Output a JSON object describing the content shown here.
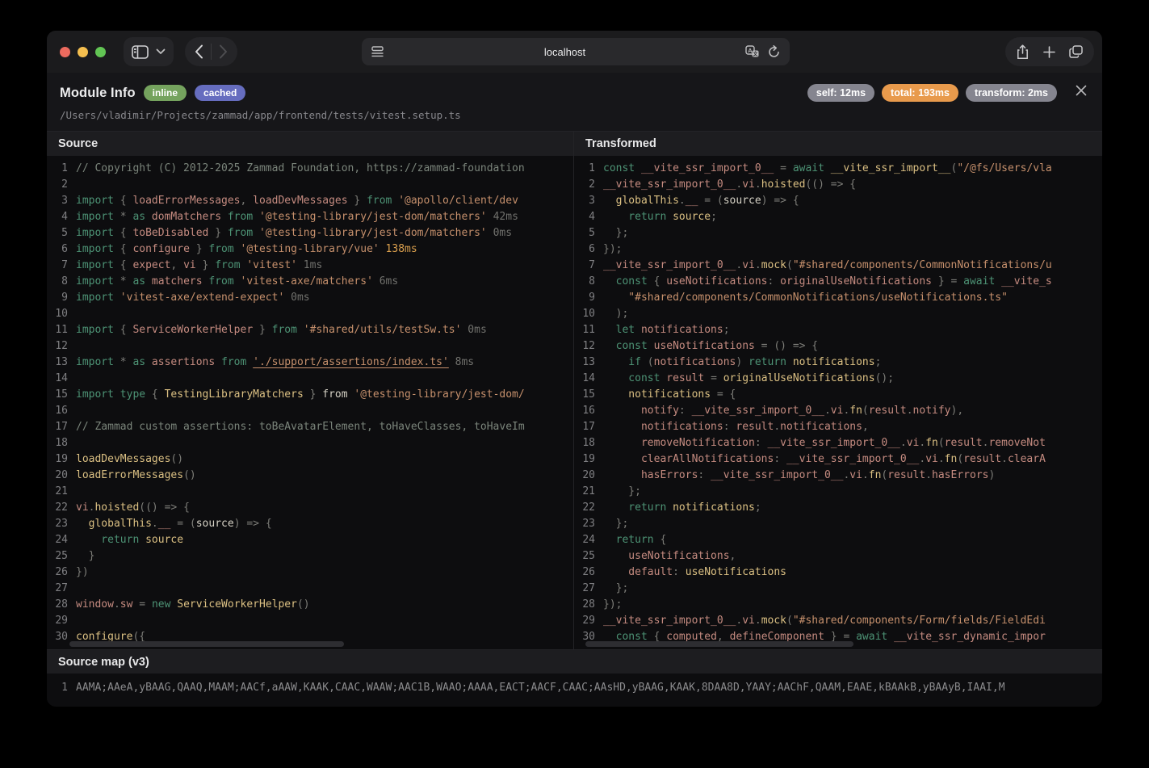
{
  "browser": {
    "url": "localhost"
  },
  "header": {
    "title": "Module Info",
    "badges": [
      {
        "label": "inline",
        "color": "#75a35e"
      },
      {
        "label": "cached",
        "color": "#666dbf"
      }
    ],
    "path": "/Users/vladimir/Projects/zammad/app/frontend/tests/vitest.setup.ts",
    "timings": [
      {
        "label": "self: 12ms",
        "color": "#85858f"
      },
      {
        "label": "total: 193ms",
        "color": "#e89a4c"
      },
      {
        "label": "transform: 2ms",
        "color": "#85858f"
      }
    ]
  },
  "panels": {
    "source": {
      "title": "Source",
      "lines": [
        [
          [
            "c",
            "// Copyright (C) 2012-2025 Zammad Foundation, https://zammad-foundation"
          ]
        ],
        [],
        [
          [
            "k",
            "import"
          ],
          [
            "p",
            " { "
          ],
          [
            "v",
            "loadErrorMessages"
          ],
          [
            "p",
            ", "
          ],
          [
            "v",
            "loadDevMessages"
          ],
          [
            "p",
            " } "
          ],
          [
            "k",
            "from"
          ],
          [
            "s",
            " '@apollo/client/dev"
          ]
        ],
        [
          [
            "k",
            "import"
          ],
          [
            "p",
            " * "
          ],
          [
            "k",
            "as"
          ],
          [
            "v",
            " domMatchers"
          ],
          [
            "k",
            " from"
          ],
          [
            "s",
            " '@testing-library/jest-dom/matchers'"
          ],
          [
            "t",
            " 42ms"
          ]
        ],
        [
          [
            "k",
            "import"
          ],
          [
            "p",
            " { "
          ],
          [
            "v",
            "toBeDisabled"
          ],
          [
            "p",
            " } "
          ],
          [
            "k",
            "from"
          ],
          [
            "s",
            " '@testing-library/jest-dom/matchers'"
          ],
          [
            "t",
            " 0ms"
          ]
        ],
        [
          [
            "k",
            "import"
          ],
          [
            "p",
            " { "
          ],
          [
            "v",
            "configure"
          ],
          [
            "p",
            " } "
          ],
          [
            "k",
            "from"
          ],
          [
            "s",
            " '@testing-library/vue'"
          ],
          [
            "th",
            " 138ms"
          ]
        ],
        [
          [
            "k",
            "import"
          ],
          [
            "p",
            " { "
          ],
          [
            "v",
            "expect"
          ],
          [
            "p",
            ", "
          ],
          [
            "v",
            "vi"
          ],
          [
            "p",
            " } "
          ],
          [
            "k",
            "from"
          ],
          [
            "s",
            " 'vitest'"
          ],
          [
            "t",
            " 1ms"
          ]
        ],
        [
          [
            "k",
            "import"
          ],
          [
            "p",
            " * "
          ],
          [
            "k",
            "as"
          ],
          [
            "v",
            " matchers"
          ],
          [
            "k",
            " from"
          ],
          [
            "s",
            " 'vitest-axe/matchers'"
          ],
          [
            "t",
            " 6ms"
          ]
        ],
        [
          [
            "k",
            "import"
          ],
          [
            "s",
            " 'vitest-axe/extend-expect'"
          ],
          [
            "t",
            " 0ms"
          ]
        ],
        [],
        [
          [
            "k",
            "import"
          ],
          [
            "p",
            " { "
          ],
          [
            "v",
            "ServiceWorkerHelper"
          ],
          [
            "p",
            " } "
          ],
          [
            "k",
            "from"
          ],
          [
            "s",
            " '#shared/utils/testSw.ts'"
          ],
          [
            "t",
            " 0ms"
          ]
        ],
        [],
        [
          [
            "k",
            "import"
          ],
          [
            "p",
            " * "
          ],
          [
            "k",
            "as"
          ],
          [
            "v",
            " assertions"
          ],
          [
            "k",
            " from "
          ],
          [
            "u",
            "'./support/assertions/index.ts'"
          ],
          [
            "t",
            " 8ms"
          ]
        ],
        [],
        [
          [
            "k",
            "import type"
          ],
          [
            "p",
            " { "
          ],
          [
            "f",
            "TestingLibraryMatchers"
          ],
          [
            "p",
            " } "
          ],
          [
            "w",
            "from"
          ],
          [
            "s",
            " '@testing-library/jest-dom/"
          ]
        ],
        [],
        [
          [
            "c",
            "// Zammad custom assertions: toBeAvatarElement, toHaveClasses, toHaveIm"
          ]
        ],
        [],
        [
          [
            "f",
            "loadDevMessages"
          ],
          [
            "p",
            "()"
          ]
        ],
        [
          [
            "f",
            "loadErrorMessages"
          ],
          [
            "p",
            "()"
          ]
        ],
        [],
        [
          [
            "v",
            "vi"
          ],
          [
            "p",
            "."
          ],
          [
            "f",
            "hoisted"
          ],
          [
            "p",
            "(() => {"
          ]
        ],
        [
          [
            "f",
            "  globalThis"
          ],
          [
            "p",
            "."
          ],
          [
            "v",
            "__"
          ],
          [
            "p",
            " = ("
          ],
          [
            "w",
            "source"
          ],
          [
            "p",
            ") => {"
          ]
        ],
        [
          [
            "k",
            "    return"
          ],
          [
            "f",
            " source"
          ]
        ],
        [
          [
            "p",
            "  }"
          ]
        ],
        [
          [
            "p",
            "})"
          ]
        ],
        [],
        [
          [
            "v",
            "window"
          ],
          [
            "p",
            "."
          ],
          [
            "v",
            "sw"
          ],
          [
            "p",
            " = "
          ],
          [
            "k",
            "new"
          ],
          [
            "f",
            " ServiceWorkerHelper"
          ],
          [
            "p",
            "()"
          ]
        ],
        [],
        [
          [
            "f",
            "configure"
          ],
          [
            "p",
            "({"
          ]
        ]
      ]
    },
    "transformed": {
      "title": "Transformed",
      "lines": [
        [
          [
            "k",
            "const"
          ],
          [
            "v",
            " __vite_ssr_import_0__"
          ],
          [
            "p",
            " = "
          ],
          [
            "k",
            "await"
          ],
          [
            "f",
            " __vite_ssr_import__"
          ],
          [
            "p",
            "("
          ],
          [
            "s",
            "\"/@fs/Users/vla"
          ]
        ],
        [
          [
            "v",
            "__vite_ssr_import_0__"
          ],
          [
            "p",
            "."
          ],
          [
            "v",
            "vi"
          ],
          [
            "p",
            "."
          ],
          [
            "f",
            "hoisted"
          ],
          [
            "p",
            "(() => {"
          ]
        ],
        [
          [
            "f",
            "  globalThis"
          ],
          [
            "p",
            "."
          ],
          [
            "v",
            "__"
          ],
          [
            "p",
            " = ("
          ],
          [
            "w",
            "source"
          ],
          [
            "p",
            ") => {"
          ]
        ],
        [
          [
            "k",
            "    return"
          ],
          [
            "f",
            " source"
          ],
          [
            "p",
            ";"
          ]
        ],
        [
          [
            "p",
            "  };"
          ]
        ],
        [
          [
            "p",
            "});"
          ]
        ],
        [
          [
            "v",
            "__vite_ssr_import_0__"
          ],
          [
            "p",
            "."
          ],
          [
            "v",
            "vi"
          ],
          [
            "p",
            "."
          ],
          [
            "f",
            "mock"
          ],
          [
            "p",
            "("
          ],
          [
            "s",
            "\"#shared/components/CommonNotifications/u"
          ]
        ],
        [
          [
            "k",
            "  const"
          ],
          [
            "p",
            " { "
          ],
          [
            "v",
            "useNotifications"
          ],
          [
            "p",
            ": "
          ],
          [
            "v",
            "originalUseNotifications"
          ],
          [
            "p",
            " } = "
          ],
          [
            "k",
            "await"
          ],
          [
            "v",
            " __vite_s"
          ]
        ],
        [
          [
            "s",
            "    \"#shared/components/CommonNotifications/useNotifications.ts\""
          ]
        ],
        [
          [
            "p",
            "  );"
          ]
        ],
        [
          [
            "k",
            "  let"
          ],
          [
            "v",
            " notifications"
          ],
          [
            "p",
            ";"
          ]
        ],
        [
          [
            "k",
            "  const"
          ],
          [
            "v",
            " useNotifications"
          ],
          [
            "p",
            " = () => {"
          ]
        ],
        [
          [
            "k",
            "    if"
          ],
          [
            "p",
            " ("
          ],
          [
            "v",
            "notifications"
          ],
          [
            "p",
            ") "
          ],
          [
            "k",
            "return"
          ],
          [
            "f",
            " notifications"
          ],
          [
            "p",
            ";"
          ]
        ],
        [
          [
            "k",
            "    const"
          ],
          [
            "v",
            " result"
          ],
          [
            "p",
            " = "
          ],
          [
            "f",
            "originalUseNotifications"
          ],
          [
            "p",
            "();"
          ]
        ],
        [
          [
            "f",
            "    notifications"
          ],
          [
            "p",
            " = {"
          ]
        ],
        [
          [
            "v",
            "      notify"
          ],
          [
            "p",
            ": "
          ],
          [
            "v",
            "__vite_ssr_import_0__"
          ],
          [
            "p",
            "."
          ],
          [
            "v",
            "vi"
          ],
          [
            "p",
            "."
          ],
          [
            "f",
            "fn"
          ],
          [
            "p",
            "("
          ],
          [
            "v",
            "result"
          ],
          [
            "p",
            "."
          ],
          [
            "v",
            "notify"
          ],
          [
            "p",
            "),"
          ]
        ],
        [
          [
            "v",
            "      notifications"
          ],
          [
            "p",
            ": "
          ],
          [
            "v",
            "result"
          ],
          [
            "p",
            "."
          ],
          [
            "v",
            "notifications"
          ],
          [
            "p",
            ","
          ]
        ],
        [
          [
            "v",
            "      removeNotification"
          ],
          [
            "p",
            ": "
          ],
          [
            "v",
            "__vite_ssr_import_0__"
          ],
          [
            "p",
            "."
          ],
          [
            "v",
            "vi"
          ],
          [
            "p",
            "."
          ],
          [
            "f",
            "fn"
          ],
          [
            "p",
            "("
          ],
          [
            "v",
            "result"
          ],
          [
            "p",
            "."
          ],
          [
            "v",
            "removeNot"
          ]
        ],
        [
          [
            "v",
            "      clearAllNotifications"
          ],
          [
            "p",
            ": "
          ],
          [
            "v",
            "__vite_ssr_import_0__"
          ],
          [
            "p",
            "."
          ],
          [
            "v",
            "vi"
          ],
          [
            "p",
            "."
          ],
          [
            "f",
            "fn"
          ],
          [
            "p",
            "("
          ],
          [
            "v",
            "result"
          ],
          [
            "p",
            "."
          ],
          [
            "v",
            "clearA"
          ]
        ],
        [
          [
            "v",
            "      hasErrors"
          ],
          [
            "p",
            ": "
          ],
          [
            "v",
            "__vite_ssr_import_0__"
          ],
          [
            "p",
            "."
          ],
          [
            "v",
            "vi"
          ],
          [
            "p",
            "."
          ],
          [
            "f",
            "fn"
          ],
          [
            "p",
            "("
          ],
          [
            "v",
            "result"
          ],
          [
            "p",
            "."
          ],
          [
            "v",
            "hasErrors"
          ],
          [
            "p",
            ")"
          ]
        ],
        [
          [
            "p",
            "    };"
          ]
        ],
        [
          [
            "k",
            "    return"
          ],
          [
            "f",
            " notifications"
          ],
          [
            "p",
            ";"
          ]
        ],
        [
          [
            "p",
            "  };"
          ]
        ],
        [
          [
            "k",
            "  return"
          ],
          [
            "p",
            " {"
          ]
        ],
        [
          [
            "v",
            "    useNotifications"
          ],
          [
            "p",
            ","
          ]
        ],
        [
          [
            "v",
            "    default"
          ],
          [
            "p",
            ": "
          ],
          [
            "f",
            "useNotifications"
          ]
        ],
        [
          [
            "p",
            "  };"
          ]
        ],
        [
          [
            "p",
            "});"
          ]
        ],
        [
          [
            "v",
            "__vite_ssr_import_0__"
          ],
          [
            "p",
            "."
          ],
          [
            "v",
            "vi"
          ],
          [
            "p",
            "."
          ],
          [
            "f",
            "mock"
          ],
          [
            "p",
            "("
          ],
          [
            "s",
            "\"#shared/components/Form/fields/FieldEdi"
          ]
        ],
        [
          [
            "k",
            "  const"
          ],
          [
            "p",
            " { "
          ],
          [
            "v",
            "computed"
          ],
          [
            "p",
            ", "
          ],
          [
            "v",
            "defineComponent"
          ],
          [
            "p",
            " } = "
          ],
          [
            "k",
            "await"
          ],
          [
            "v",
            " __vite_ssr_dynamic_impor"
          ]
        ]
      ]
    }
  },
  "sourcemap": {
    "title": "Source map (v3)",
    "line_number": "1",
    "mappings": "AAMA;AAeA,yBAAG,QAAQ,MAAM;AACf,aAAW,KAAK,CAAC,WAAW;AAC1B,WAAO;AAAA,EACT;AACF,CAAC;AAsHD,yBAAG,KAAK,8DAA8D,YAAY;AAChF,QAAM,EAAE,kBAAkB,yBAAyB,IAAI,M"
  }
}
